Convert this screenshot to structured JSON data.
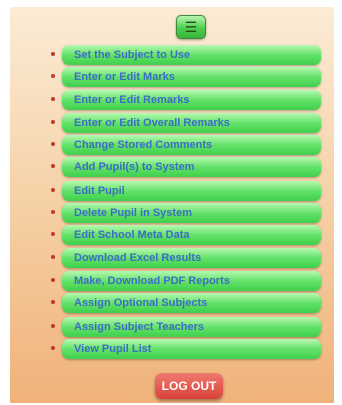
{
  "menu_toggle": {
    "icon": "hamburger-icon"
  },
  "menu_items": [
    {
      "label": "Set the Subject to Use"
    },
    {
      "label": "Enter or Edit Marks"
    },
    {
      "label": "Enter or Edit Remarks"
    },
    {
      "label": "Enter or Edit Overall Remarks"
    },
    {
      "label": "Change Stored Comments"
    },
    {
      "label": "Add Pupil(s) to System"
    },
    {
      "label": "Edit Pupil"
    },
    {
      "label": "Delete Pupil in System"
    },
    {
      "label": "Edit School Meta Data"
    },
    {
      "label": "Download Excel Results"
    },
    {
      "label": "Make, Download PDF Reports"
    },
    {
      "label": "Assign Optional Subjects"
    },
    {
      "label": "Assign Subject Teachers"
    },
    {
      "label": "View Pupil List"
    }
  ],
  "logout_label": "LOG OUT",
  "colors": {
    "item_gradient_top": "#b7f9b1",
    "item_gradient_bottom": "#3fcf4b",
    "item_text": "#3c6dc7",
    "bullet": "#c0392b",
    "logout_bg": "#d9413a",
    "panel_bottom": "#f0b27a"
  }
}
